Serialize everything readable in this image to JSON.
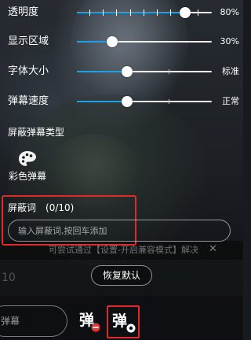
{
  "settings": {
    "opacity": {
      "label": "透明度",
      "value": "80%",
      "fraction": 0.8
    },
    "display_area": {
      "label": "显示区域",
      "value": "30%",
      "fraction": 0.26
    },
    "font_size": {
      "label": "字体大小",
      "value": "标准",
      "fraction": 0.37
    },
    "speed": {
      "label": "弹幕速度",
      "value": "正常",
      "fraction": 0.37
    }
  },
  "block_types": {
    "title": "屏蔽弹幕类型",
    "color_danmu_label": "彩色弹幕"
  },
  "filter": {
    "title": "屏蔽词",
    "count": "(0/10)",
    "placeholder": "输入屏蔽词,按回车添加"
  },
  "reset_button": "恢复默认",
  "background_overlay": {
    "tip": "可尝试通过【设置-开启兼容模式】解决",
    "close": "✕",
    "partial_number": "10"
  },
  "bottom": {
    "input_placeholder": "弹幕",
    "toggle_glyph": "弹",
    "setting_glyph": "弹"
  },
  "colors": {
    "accent": "#1ea0e6",
    "highlight": "#e02a2a",
    "toggle_off": "#e53935"
  },
  "icons": [
    "palette-icon",
    "close-icon",
    "danmu-off-icon",
    "danmu-settings-icon"
  ]
}
